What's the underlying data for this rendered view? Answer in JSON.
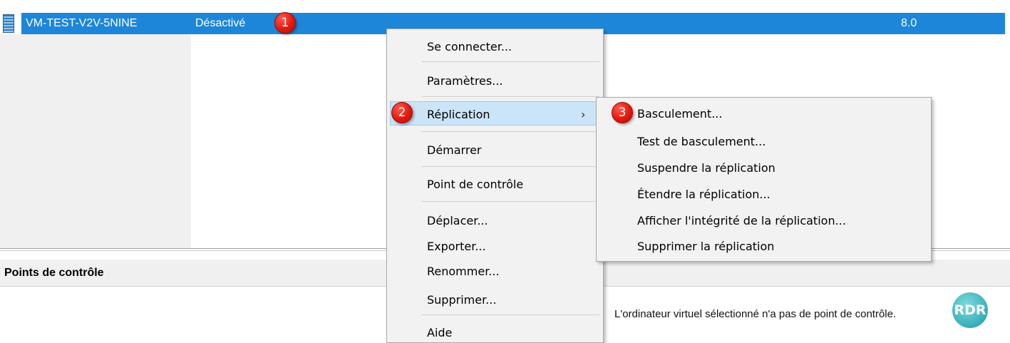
{
  "vm_list": {
    "row": {
      "name": "VM-TEST-V2V-5NINE",
      "state": "Désactivé",
      "version": "8.0"
    }
  },
  "badges": [
    "1",
    "2",
    "3"
  ],
  "context_menu": {
    "items": [
      "Se connecter...",
      "Paramètres...",
      "Réplication",
      "Démarrer",
      "Point de contrôle",
      "Déplacer...",
      "Exporter...",
      "Renommer...",
      "Supprimer...",
      "Aide"
    ],
    "submenu_arrow": "›"
  },
  "replication_submenu": {
    "items": [
      "Basculement...",
      "Test de basculement...",
      "Suspendre la réplication",
      "Étendre la réplication...",
      "Afficher l'intégrité de la réplication...",
      "Supprimer la réplication"
    ]
  },
  "checkpoints_panel": {
    "title": "Points de contrôle",
    "empty_message": "L'ordinateur virtuel sélectionné n'a pas de point de contrôle."
  },
  "watermark": {
    "text": "RDR"
  },
  "colors": {
    "selection": "#1e86d9",
    "menu_highlight": "#cce4f7",
    "badge": "#e3180e",
    "logo": "#36aeb8"
  },
  "icons": {
    "vm": "virtual-machine-icon",
    "arrow": "chevron-right-icon"
  }
}
